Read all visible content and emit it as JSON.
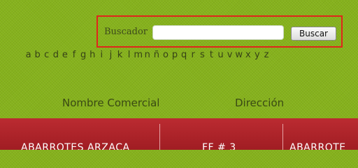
{
  "search": {
    "label": "Buscador",
    "value": "",
    "placeholder": "",
    "button_label": "Buscar"
  },
  "alphabet": [
    "a",
    "b",
    "c",
    "d",
    "e",
    "f",
    "g",
    "h",
    "i",
    "j",
    "k",
    "l",
    "m",
    "n",
    "ñ",
    "o",
    "p",
    "q",
    "r",
    "s",
    "t",
    "u",
    "v",
    "w",
    "x",
    "y",
    "z"
  ],
  "table": {
    "headers": [
      "Nombre Comercial",
      "Dirección"
    ],
    "first_row": [
      "ABARROTES ARZACA",
      "FF # 3",
      "ABARROTE"
    ]
  },
  "colors": {
    "background": "#86b21c",
    "highlight_border": "#e0261b",
    "table_band": "#b0252b"
  }
}
